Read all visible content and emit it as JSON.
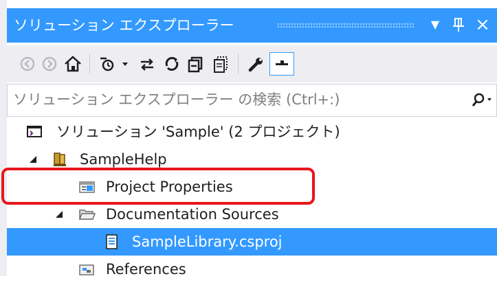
{
  "window": {
    "title": "ソリューション エクスプローラー",
    "menu_glyph": "▼",
    "pin_glyph": "ᵠ",
    "close_glyph": "×"
  },
  "toolbar": {
    "buttons": [
      "back-icon",
      "forward-icon",
      "home-icon",
      "pending-changes-filter-icon",
      "dropdown-icon",
      "sync-icon",
      "refresh-icon",
      "collapse-all-icon",
      "show-all-files-icon",
      "properties-icon",
      "preview-icon"
    ]
  },
  "search": {
    "placeholder": "ソリューション エクスプローラー の検索 (Ctrl+:)"
  },
  "tree": {
    "solution": "ソリューション 'Sample' (2 プロジェクト)",
    "project": "SampleHelp",
    "project_properties": "Project Properties",
    "documentation_sources": "Documentation Sources",
    "sample_library": "SampleLibrary.csproj",
    "references": "References"
  },
  "colors": {
    "accent": "#3399ff",
    "highlight": "#e8151b",
    "toolbar": "#eeeef2"
  }
}
